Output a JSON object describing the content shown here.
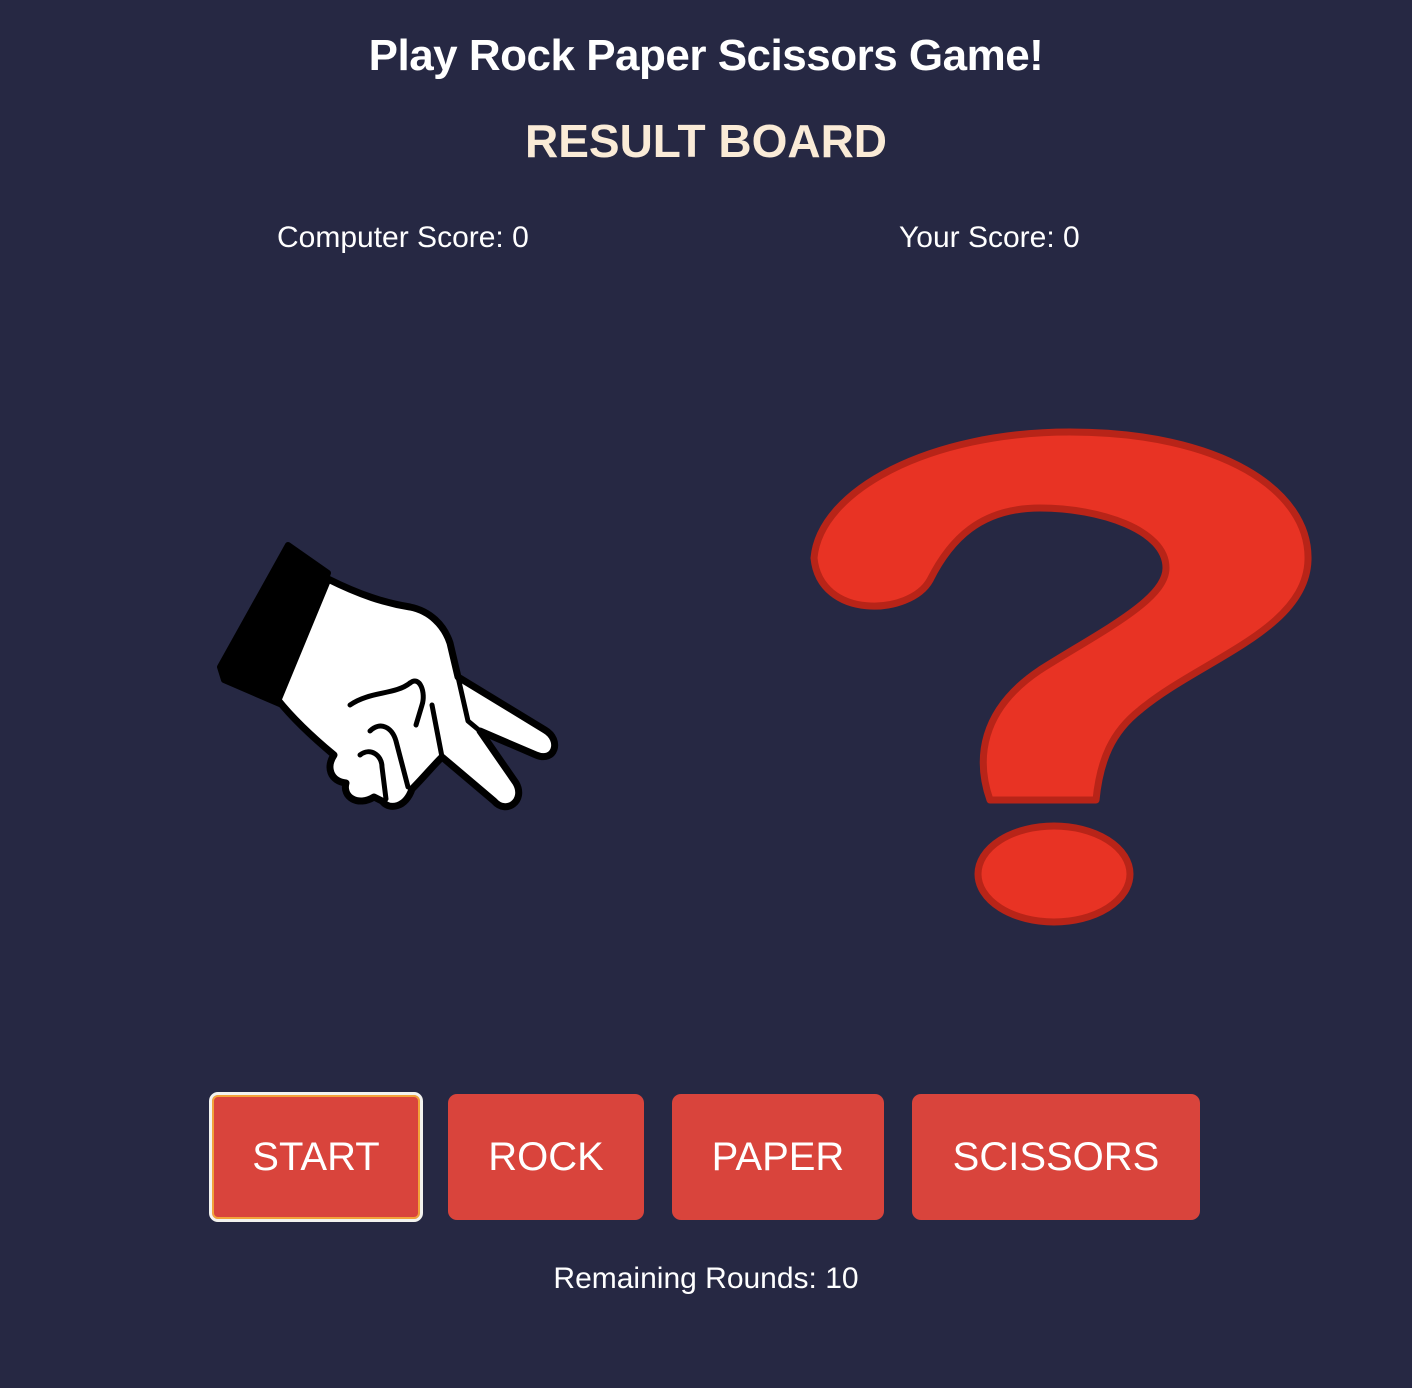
{
  "header": {
    "title": "Play Rock Paper Scissors Game!",
    "subtitle": "RESULT BOARD"
  },
  "scores": {
    "computer_label": "Computer Score: 0",
    "computer_value": 0,
    "player_label": "Your Score: 0",
    "player_value": 0
  },
  "display": {
    "computer_choice_icon": "scissors-hand-icon",
    "player_choice_icon": "question-mark-icon"
  },
  "controls": {
    "start_label": "START",
    "rock_label": "ROCK",
    "paper_label": "PAPER",
    "scissors_label": "SCISSORS"
  },
  "footer": {
    "rounds_label": "Remaining Rounds: 10",
    "rounds_value": 10
  },
  "colors": {
    "background": "#262843",
    "button": "#d9443c",
    "subtitle": "#faebd7",
    "question_mark": "#e83324"
  }
}
